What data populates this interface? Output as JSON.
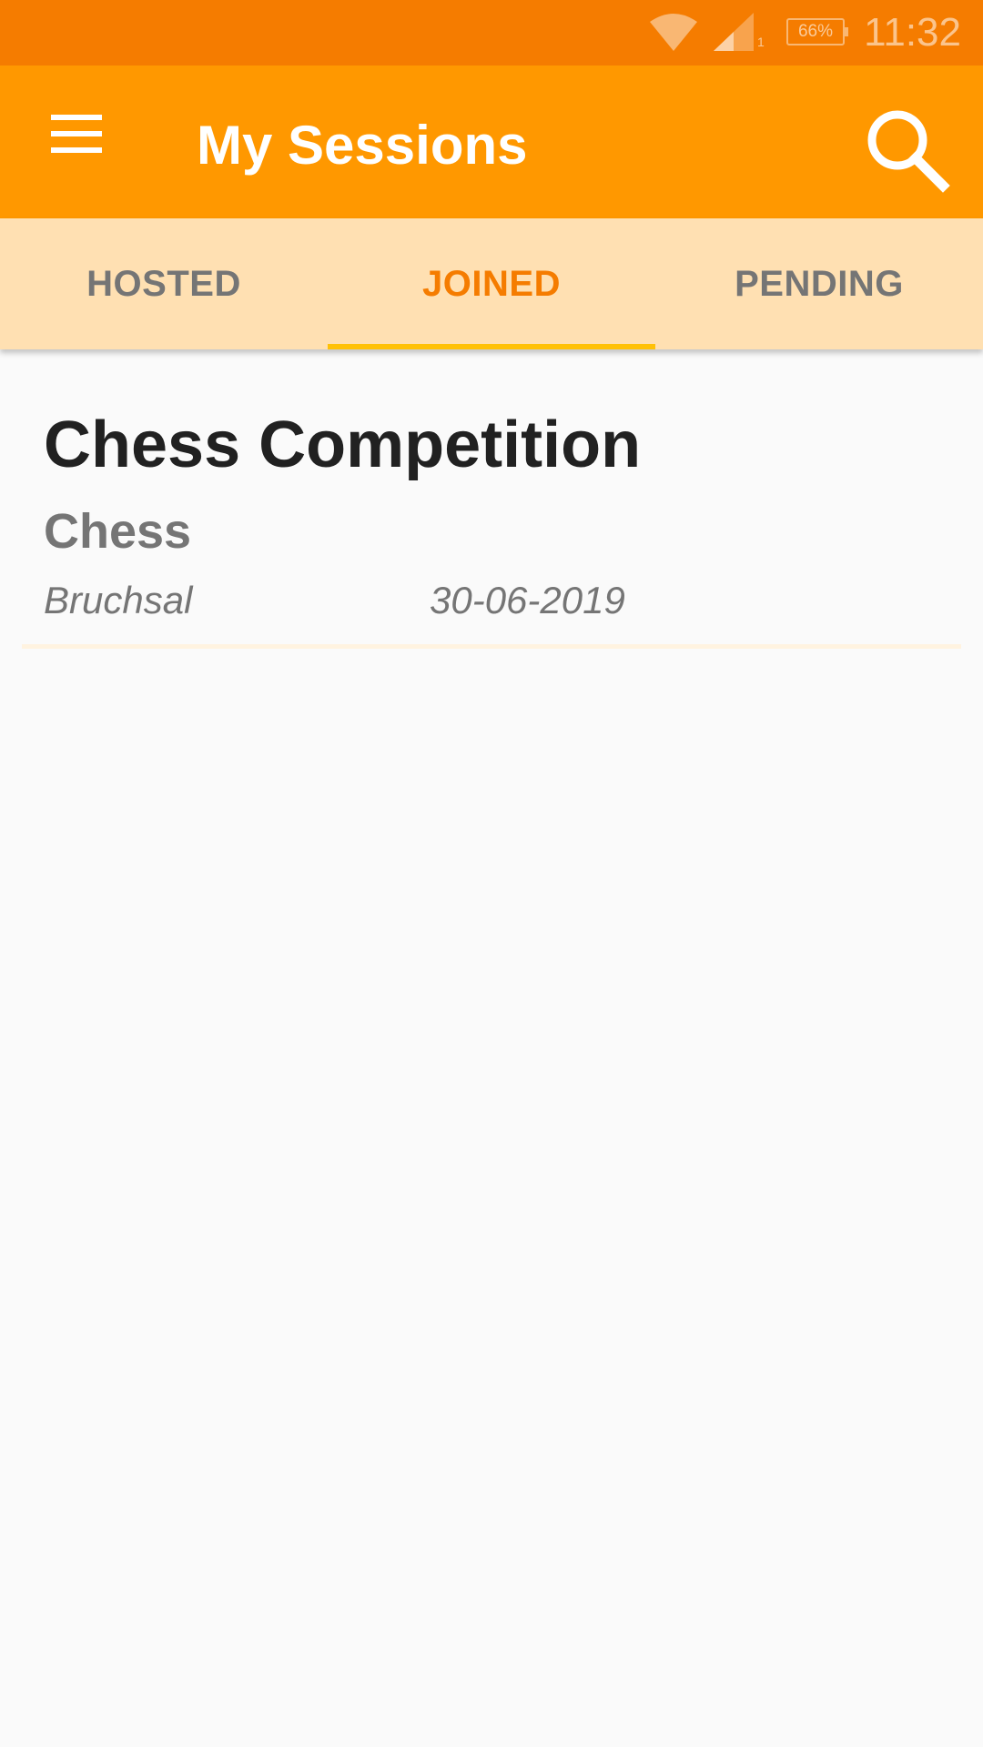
{
  "status_bar": {
    "battery_percent": "66%",
    "time": "11:32",
    "sim_slot": "1",
    "icons": [
      "wifi-icon",
      "signal-icon",
      "battery-icon"
    ]
  },
  "app_bar": {
    "title": "My Sessions",
    "menu_icon": "hamburger-menu-icon",
    "search_icon": "search-icon",
    "background_color": "#ff9800",
    "status_color": "#f57c00"
  },
  "tabs": [
    {
      "label": "HOSTED",
      "active": false
    },
    {
      "label": "JOINED",
      "active": true
    },
    {
      "label": "PENDING",
      "active": false
    }
  ],
  "tab_colors": {
    "background": "#ffe0b2",
    "active_text": "#f57c00",
    "inactive_text": "#757575",
    "indicator": "#ffc107"
  },
  "sessions": [
    {
      "title": "Chess Competition",
      "category": "Chess",
      "location": "Bruchsal",
      "date": "30-06-2019"
    }
  ]
}
